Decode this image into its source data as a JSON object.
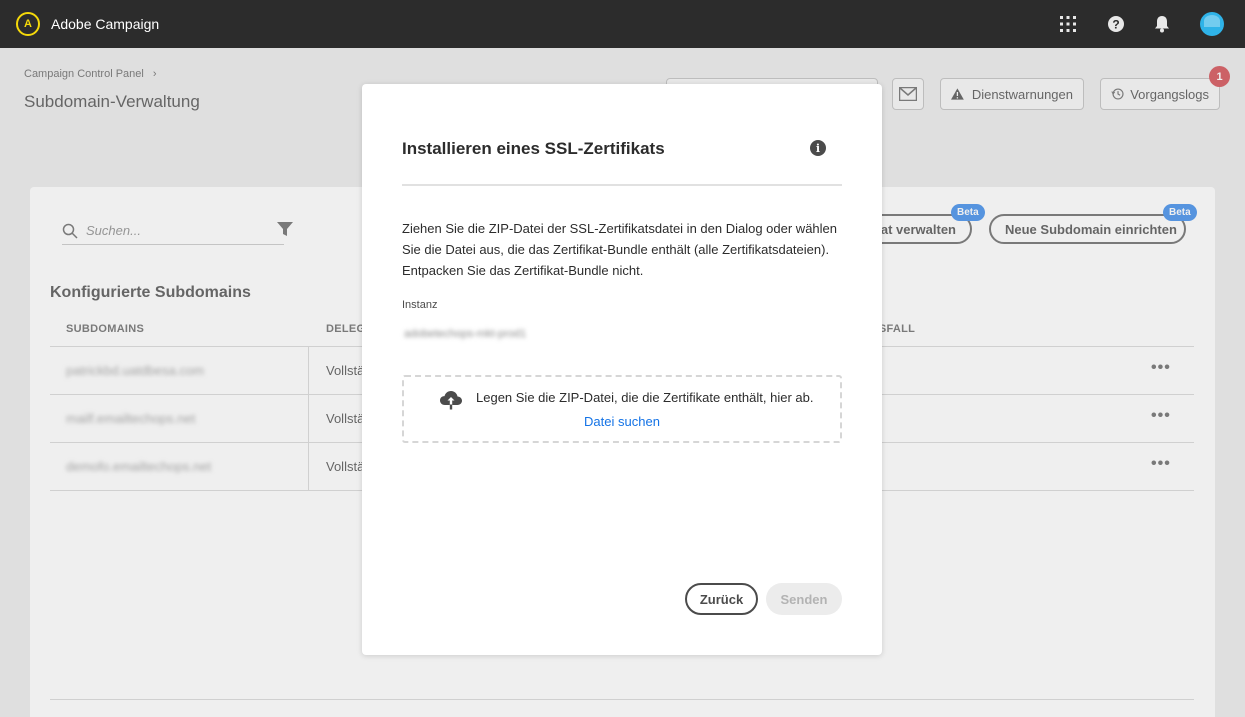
{
  "app": {
    "title": "Adobe Campaign",
    "logo_glyph": "A"
  },
  "topbar": {
    "icons": [
      "apps-grid-icon",
      "help-icon",
      "bell-icon",
      "avatar"
    ]
  },
  "header": {
    "breadcrumb": "Campaign Control Panel",
    "breadcrumb_sep": "›",
    "page_title": "Subdomain-Verwaltung",
    "buttons": {
      "warnings_label": "Dienstwarnungen",
      "logs_label": "Vorgangslogs",
      "logs_count": "1"
    }
  },
  "card": {
    "search_placeholder": "Suchen...",
    "manage_cert_label": "kat verwalten",
    "new_subdomain_label": "Neue Subdomain einrichten",
    "beta_label": "Beta",
    "section_title": "Konfigurierte Subdomains",
    "columns": [
      "SUBDOMAINS",
      "DELEG",
      "GSFALL"
    ],
    "rows": [
      {
        "subdomain": "patrickbd.uatdbesa.com",
        "delegation": "Vollstä",
        "more": "•••"
      },
      {
        "subdomain": "mailf.emailtechops.net",
        "delegation": "Vollstä",
        "more": "•••"
      },
      {
        "subdomain": "demofo.emailtechops.net",
        "delegation": "Vollstä",
        "more": "•••"
      }
    ]
  },
  "modal": {
    "title": "Installieren eines SSL-Zertifikats",
    "info_glyph": "i",
    "description": "Ziehen Sie die ZIP-Datei der SSL-Zertifikatsdatei in den Dialog oder wählen Sie die Datei aus, die das Zertifikat-Bundle enthält (alle Zertifikatsdateien). Entpacken Sie das Zertifikat-Bundle nicht.",
    "instance_label": "Instanz",
    "instance_value": "adobetechops-mkt-prod1",
    "drop_text": "Legen Sie die ZIP-Datei, die die Zertifikate enthält, hier ab.",
    "drop_link": "Datei suchen",
    "back_label": "Zurück",
    "send_label": "Senden"
  },
  "colors": {
    "topbar": "#2c2c2c",
    "accent_blue": "#1473e6",
    "badge_red": "#c9252d",
    "logo_yellow": "#f5d90a"
  }
}
